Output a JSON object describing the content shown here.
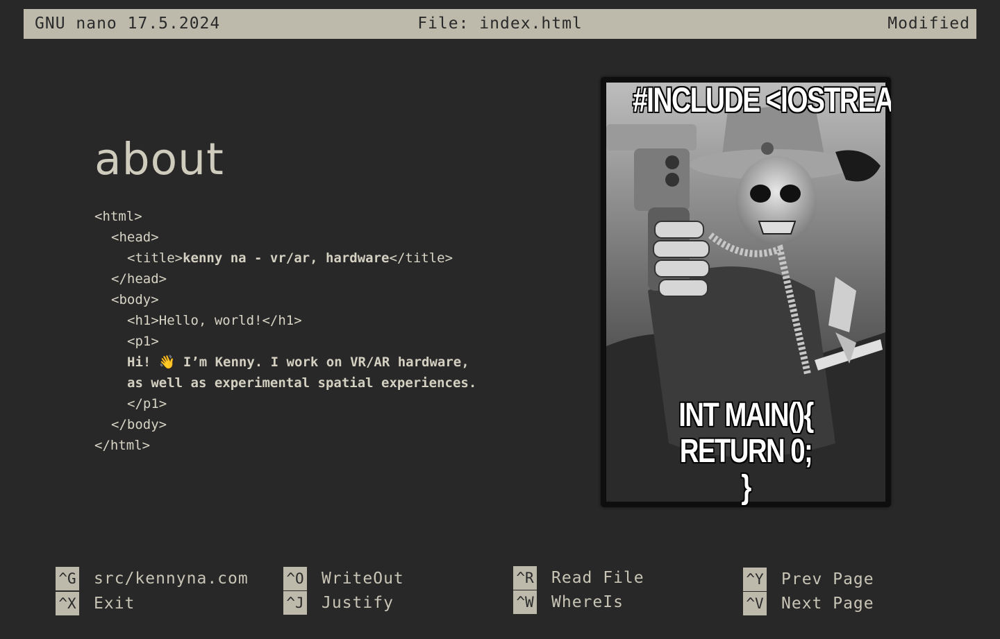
{
  "titlebar": {
    "app": "GNU nano 17.5.2024",
    "file": "File: index.html",
    "status": "Modified"
  },
  "content": {
    "heading": "about",
    "code": {
      "l1": "<html>",
      "l2": "<head>",
      "l3_open": "<title>",
      "l3_text": "kenny na - vr/ar, hardware",
      "l3_close": "</title>",
      "l4": "</head>",
      "l5": "<body>",
      "l6": "<h1>Hello, world!</h1>",
      "l7": "<p1>",
      "l8": "Hi! 👋 I’m Kenny. I work on VR/AR hardware,",
      "l9": "as well as experimental spatial experiences.",
      "l10": "</p1>",
      "l11": "</body>",
      "l12": "</html>"
    }
  },
  "meme": {
    "top_text": "#INCLUDE <IOSTREAM>",
    "bottom_line1": "INT MAIN(){",
    "bottom_line2": "RETURN 0;",
    "bottom_line3": "}"
  },
  "shortcuts": [
    {
      "key": "^G",
      "label": "src/kennyna.com"
    },
    {
      "key": "^X",
      "label": "Exit"
    },
    {
      "key": "^O",
      "label": "WriteOut"
    },
    {
      "key": "^J",
      "label": "Justify"
    },
    {
      "key": "^R",
      "label": "Read File"
    },
    {
      "key": "^W",
      "label": "WhereIs"
    },
    {
      "key": "^Y",
      "label": "Prev Page"
    },
    {
      "key": "^V",
      "label": "Next Page"
    }
  ]
}
